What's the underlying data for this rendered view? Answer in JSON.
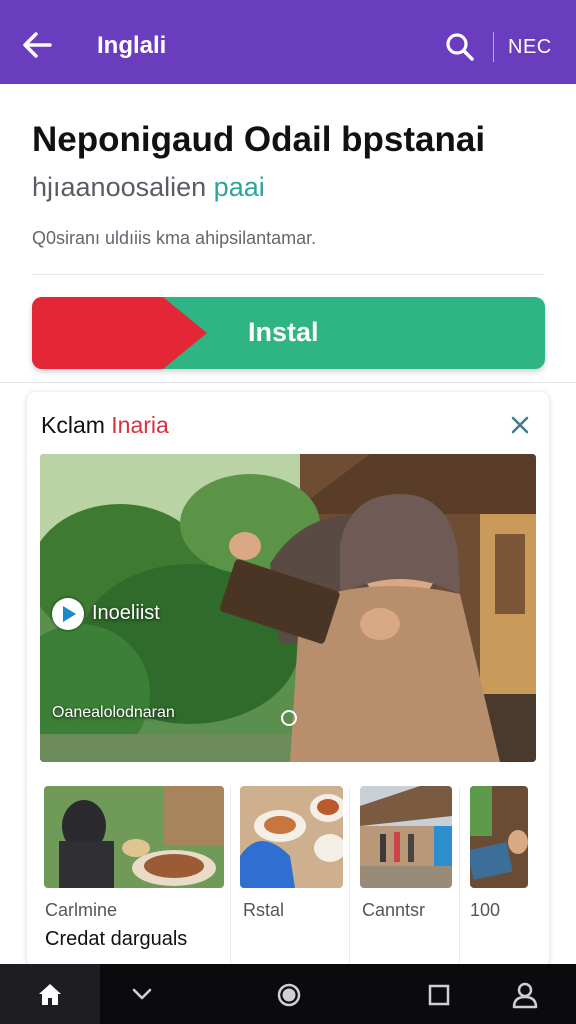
{
  "appbar": {
    "back_icon": "arrow-left-icon",
    "title": "Inglali",
    "search_icon": "search-icon",
    "right_label": "NEC",
    "color": "#6a3dbf"
  },
  "app": {
    "name": "Neponigaud Odail bpstanai",
    "subtitle_main": "hjıaanoosalien",
    "subtitle_accent": "paai",
    "description": "Q0siranı uldıiis kma ahipsilantamar.",
    "install_label": "Instal",
    "install_colors": {
      "left": "#e32737",
      "right": "#2fb583"
    }
  },
  "card": {
    "title_main": "Kclam",
    "title_accent": "Inaria",
    "close_icon": "close-icon",
    "hero": {
      "play_icon": "play-icon",
      "label": "Inoeliist",
      "caption": "Oanealolodnaran"
    },
    "thumbnails": [
      {
        "caption": "Carlmine"
      },
      {
        "caption": "Rstal"
      },
      {
        "caption": "Canntsr"
      },
      {
        "caption": "100"
      }
    ],
    "subcaption": "Credat darguals"
  },
  "navbar": {
    "items": [
      "home-icon",
      "chevron-down-icon",
      "circle-icon",
      "square-icon",
      "profile-icon"
    ]
  }
}
